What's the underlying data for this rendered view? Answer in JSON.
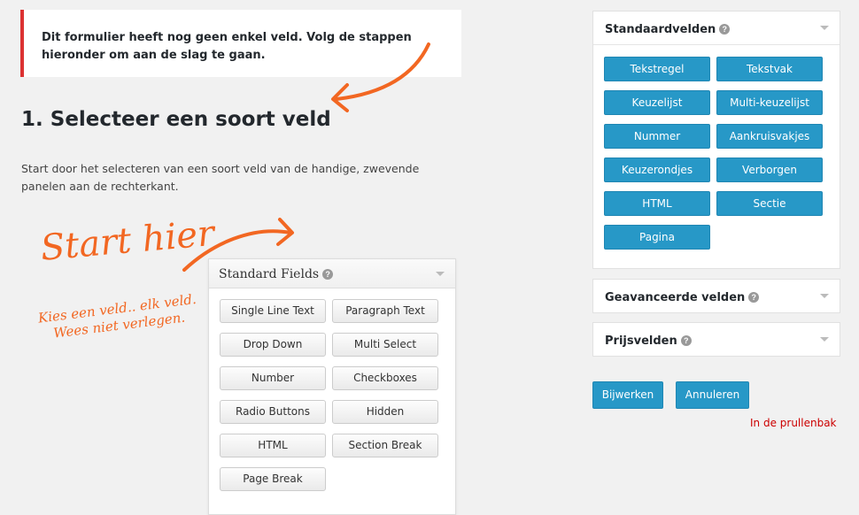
{
  "notice": {
    "text": "Dit formulier heeft nog geen enkel veld. Volg de stappen hieronder om aan de slag te gaan."
  },
  "step": {
    "title": "1. Selecteer een soort veld",
    "description": "Start door het selecteren van een soort veld van de handige, zwevende panelen aan de rechterkant."
  },
  "handwriting": {
    "start": "Start hier",
    "note_line1": "Kies een veld.. elk veld.",
    "note_line2": "Wees niet verlegen."
  },
  "example_panel": {
    "title": "Standard Fields",
    "buttons": [
      "Single Line Text",
      "Paragraph Text",
      "Drop Down",
      "Multi Select",
      "Number",
      "Checkboxes",
      "Radio Buttons",
      "Hidden",
      "HTML",
      "Section Break",
      "Page Break"
    ]
  },
  "sidebar": {
    "standard": {
      "title": "Standaardvelden",
      "buttons": [
        "Tekstregel",
        "Tekstvak",
        "Keuzelijst",
        "Multi-keuzelijst",
        "Nummer",
        "Aankruisvakjes",
        "Keuzerondjes",
        "Verborgen",
        "HTML",
        "Sectie",
        "Pagina"
      ]
    },
    "advanced": {
      "title": "Geavanceerde velden"
    },
    "pricing": {
      "title": "Prijsvelden"
    }
  },
  "actions": {
    "update": "Bijwerken",
    "cancel": "Annuleren",
    "trash": "In de prullenbak"
  },
  "colors": {
    "accent": "#2798c7",
    "notice_border": "#dc3232",
    "handwriting": "#f26722",
    "trash": "#cc0000"
  },
  "icons": {
    "help": "question-circle-icon",
    "collapse": "caret-down-icon",
    "arrow": "hand-drawn-arrow-icon"
  }
}
